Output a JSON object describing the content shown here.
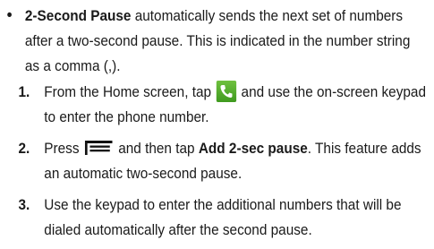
{
  "bullet": {
    "title": "2-Second Pause",
    "text": " automatically sends the next set of numbers after a two-second pause. This is indicated in the number string as a comma (,)."
  },
  "steps": [
    {
      "number": "1.",
      "text_before": "From the Home screen, tap",
      "icon": "phone-app-icon",
      "text_after": "and use the on-screen keypad to enter the phone number."
    },
    {
      "number": "2.",
      "text_before": "Press",
      "icon": "menu-key-icon",
      "text_middle": "and then tap",
      "bold": "Add 2-sec pause",
      "text_after": ". This feature adds an automatic two-second pause."
    },
    {
      "number": "3.",
      "text": "Use the keypad to enter the additional numbers that will be dialed automatically after the second pause."
    }
  ],
  "colors": {
    "phone_icon": "#4caf2a",
    "text": "#1a1a1a"
  }
}
